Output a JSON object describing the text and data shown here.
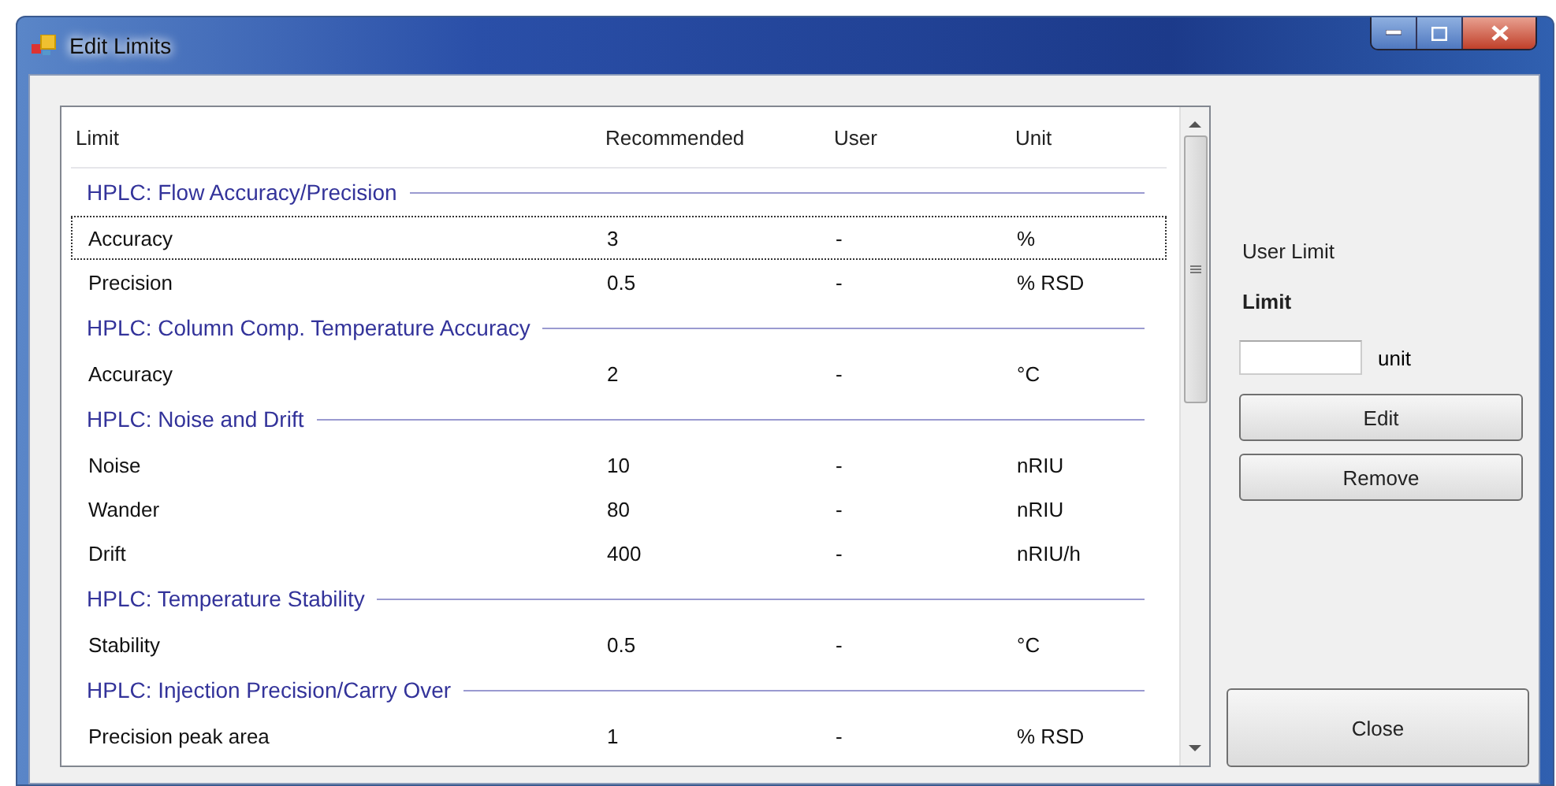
{
  "window": {
    "title": "Edit Limits"
  },
  "list": {
    "columns": [
      "Limit",
      "Recommended",
      "User",
      "Unit"
    ],
    "groups": [
      {
        "title": "HPLC: Flow Accuracy/Precision",
        "rows": [
          {
            "limit": "Accuracy",
            "recommended": "3",
            "user": "-",
            "unit": "%",
            "selected": true
          },
          {
            "limit": "Precision",
            "recommended": "0.5",
            "user": "-",
            "unit": "% RSD",
            "selected": false
          }
        ]
      },
      {
        "title": "HPLC: Column Comp. Temperature Accuracy",
        "rows": [
          {
            "limit": "Accuracy",
            "recommended": "2",
            "user": "-",
            "unit": "°C",
            "selected": false
          }
        ]
      },
      {
        "title": "HPLC: Noise and Drift",
        "rows": [
          {
            "limit": "Noise",
            "recommended": "10",
            "user": "-",
            "unit": "nRIU",
            "selected": false
          },
          {
            "limit": "Wander",
            "recommended": "80",
            "user": "-",
            "unit": "nRIU",
            "selected": false
          },
          {
            "limit": "Drift",
            "recommended": "400",
            "user": "-",
            "unit": "nRIU/h",
            "selected": false
          }
        ]
      },
      {
        "title": "HPLC: Temperature Stability",
        "rows": [
          {
            "limit": "Stability",
            "recommended": "0.5",
            "user": "-",
            "unit": "°C",
            "selected": false
          }
        ]
      },
      {
        "title": "HPLC: Injection Precision/Carry Over",
        "rows": [
          {
            "limit": "Precision peak area",
            "recommended": "1",
            "user": "-",
            "unit": "% RSD",
            "selected": false
          }
        ]
      }
    ]
  },
  "panel": {
    "heading": "User Limit",
    "label": "Limit",
    "unit": "unit",
    "buttons": [
      "Edit",
      "Remove"
    ],
    "close": "Close"
  }
}
